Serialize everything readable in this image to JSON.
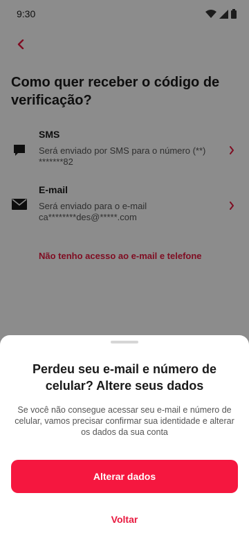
{
  "status_bar": {
    "time": "9:30",
    "icons": [
      "wifi-icon",
      "signal-icon",
      "battery-icon"
    ]
  },
  "header": {
    "back_icon": "chevron-left-icon",
    "title": "Como quer receber o código de verificação?"
  },
  "options": [
    {
      "icon": "message-icon",
      "title": "SMS",
      "description": "Será enviado por SMS para o número (**) *******82"
    },
    {
      "icon": "mail-icon",
      "title": "E-mail",
      "description": "Será enviado para o e-mail ca********des@*****.com"
    }
  ],
  "no_access_link": "Não tenho acesso ao e-mail e telefone",
  "bottom_sheet": {
    "title": "Perdeu seu e-mail e número de celular? Altere seus dados",
    "text": "Se você não consegue acessar seu e-mail e número de celular, vamos precisar confirmar sua identidade e alterar os dados da sua conta",
    "primary_button": "Alterar dados",
    "secondary_link": "Voltar"
  },
  "colors": {
    "accent": "#f5173f",
    "link": "#e8193f",
    "overlay": "rgba(0,0,0,0.45)"
  }
}
